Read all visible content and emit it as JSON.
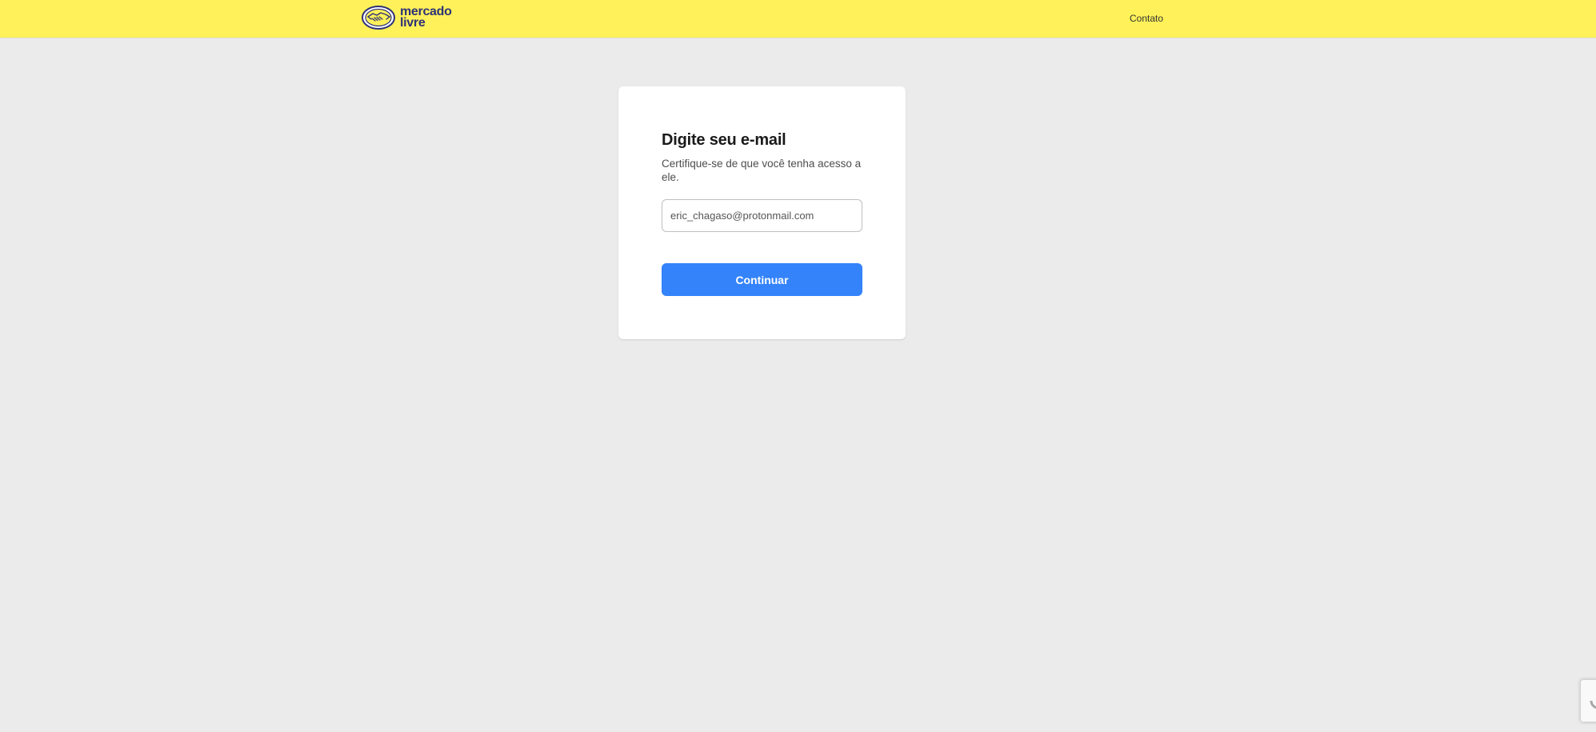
{
  "header": {
    "logo": {
      "icon": "handshake-icon",
      "line1": "mercado",
      "line2": "livre"
    },
    "contact_label": "Contato"
  },
  "form": {
    "title": "Digite seu e-mail",
    "subtitle": "Certifique-se de que você tenha acesso a ele.",
    "email_value": "eric_chagaso@protonmail.com",
    "continue_label": "Continuar"
  },
  "recaptcha": {
    "icon": "recaptcha-icon"
  },
  "colors": {
    "header_background": "#fff159",
    "page_background": "#ebebeb",
    "primary_button": "#3483fa",
    "logo_text": "#2d3277"
  }
}
